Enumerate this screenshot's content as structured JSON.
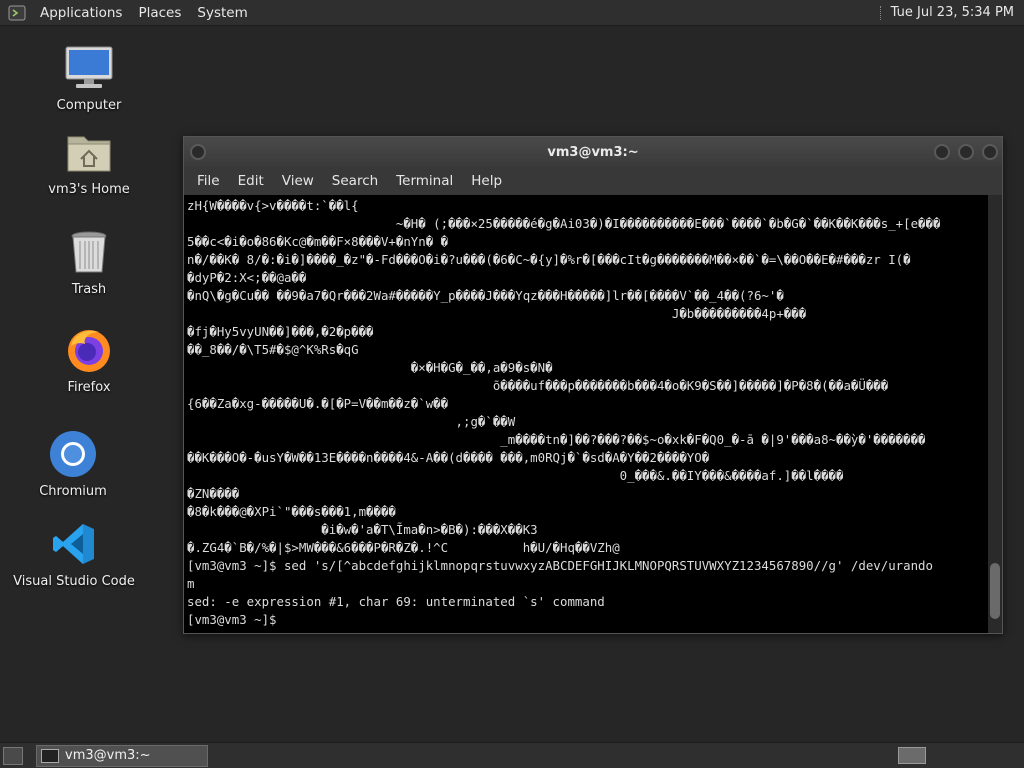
{
  "top_panel": {
    "menu": [
      "Applications",
      "Places",
      "System"
    ],
    "clock": "Tue Jul 23,  5:34 PM"
  },
  "desktop": {
    "icons": [
      {
        "label": "Computer",
        "icon": "computer-icon"
      },
      {
        "label": "vm3's Home",
        "icon": "home-folder-icon"
      },
      {
        "label": "Trash",
        "icon": "trash-icon"
      },
      {
        "label": "Firefox",
        "icon": "firefox-icon"
      },
      {
        "label": "Chromium",
        "icon": "chromium-icon"
      },
      {
        "label": "Visual Studio Code",
        "icon": "vscode-icon"
      }
    ]
  },
  "window": {
    "title": "vm3@vm3:~",
    "menu": [
      "File",
      "Edit",
      "View",
      "Search",
      "Terminal",
      "Help"
    ],
    "terminal_lines": [
      "zH{W����v{>v����t:`��l{",
      "                            ~�H� (;���×25�����é�g�Ai03�)�I����������E���`����`�b�G�`��K��K���s_+[e���",
      "5��c<�i�o�86�Kϲ@�m��F×8���V+�nYn� �",
      "ո�/��K� 8/�:�i�]����_�z\"�-Fd���O�i�?u���(�6�C~�{y]�%r�[���cIt�g�������M��×��`�=\\��O��E�#���zr I(�",
      "�dyP�2:X<;��@a��",
      "�nQ\\�g�Cu�� ��9�a7�Qr���2Wa#�����Y_p����J���Yqz���H�����]lr��[����V`��_4��(?6~'�",
      "                                                                 J�b���������4p+���",
      "�fj�Hy5vyUN��]���,�2�p���",
      "��_8��/�\\T5#�$@^K%Rs�qG",
      "                              �×�H�G�_��,a�9�s�N�",
      "                                         õ����uf���p�������b���4�o�K9�S��]�����]�P�8�(��a�Ü���",
      "{6��Za�xg-�����U�.�[�P=V��m��z�`w��",
      "                                    ,;g�`��W",
      "                                          _m����tn�]��?���?��$~o�xk�F�Q0_�-ā �|9'���a8~��ỳ�'�������",
      "��K���O�-�usY�W��13E����n����4&-A��(d���� ���,m0RQj�`�sd�A�Y��2����YO�",
      "                                                          0_���&.��IY���&����af.]��l����",
      "�ZN����",
      "�8�k���@�XPi`\"���s���1,m����",
      "                  �i�w�'a�T\\Ĩma�n>�B�):���X��K3",
      "�.ZG4�`B�/%�|$>MW���&6���P�R�Z�.!^C          h�U/�Hq��VZh@",
      "[vm3@vm3 ~]$ sed 's/[^abcdefghijklmnopqrstuvwxyzABCDEFGHIJKLMNOPQRSTUVWXYZ1234567890//g' /dev/urando",
      "m",
      "sed: -e expression #1, char 69: unterminated `s' command",
      "[vm3@vm3 ~]$ "
    ]
  },
  "bottom_panel": {
    "task_label": "vm3@vm3:~"
  }
}
